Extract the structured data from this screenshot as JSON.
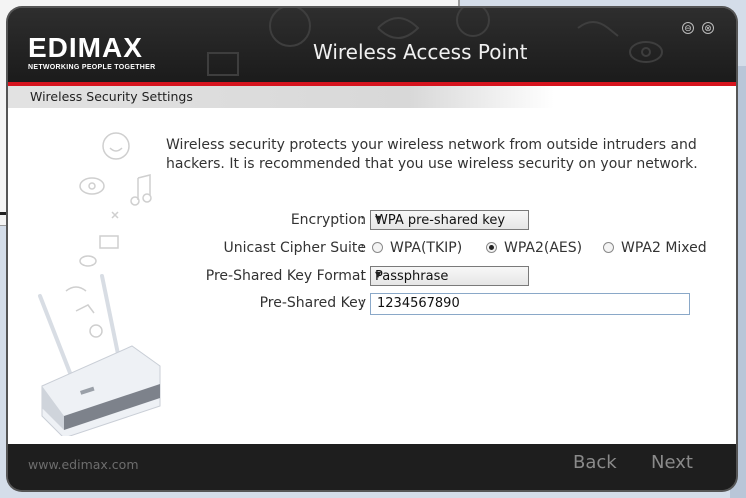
{
  "header": {
    "logo": "EDIMAX",
    "tagline": "NETWORKING PEOPLE TOGETHER",
    "title": "Wireless Access Point"
  },
  "window_controls": {
    "minimize": "⊖",
    "close": "⊗"
  },
  "section": {
    "title": "Wireless Security Settings"
  },
  "intro": "Wireless security protects your wireless network from outside intruders and hackers. It is recommended that you use wireless security on your network.",
  "form": {
    "encryption": {
      "label": "Encryption",
      "value": "WPA pre-shared key"
    },
    "cipher": {
      "label": "Unicast Cipher Suite",
      "options": [
        "WPA(TKIP)",
        "WPA2(AES)",
        "WPA2 Mixed"
      ],
      "selected": "WPA2(AES)"
    },
    "key_format": {
      "label": "Pre-Shared Key Format",
      "value": "Passphrase"
    },
    "psk": {
      "label": "Pre-Shared Key",
      "value": "1234567890"
    }
  },
  "footer": {
    "url": "www.edimax.com",
    "back": "Back",
    "next": "Next"
  },
  "colors": {
    "accent_red": "#d6141e",
    "header_dark": "#1c1c1c"
  }
}
